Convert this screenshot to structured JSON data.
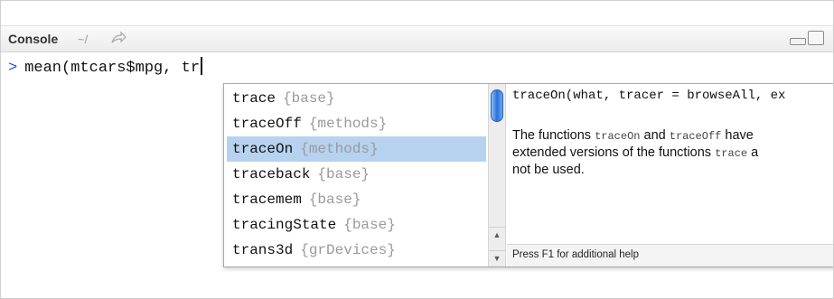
{
  "console": {
    "title": "Console",
    "path": "~/",
    "prompt_symbol": ">",
    "input_text": "mean(mtcars$mpg, tr"
  },
  "icons": {
    "path_arrow": "redirect-arrow-icon",
    "minimize": "minimize-icon",
    "maximize": "maximize-icon",
    "scroll_up": "up-arrow-icon",
    "scroll_down": "down-arrow-icon"
  },
  "completions": {
    "selected_index": 2,
    "items": [
      {
        "name": "trace",
        "package": "{base}"
      },
      {
        "name": "traceOff",
        "package": "{methods}"
      },
      {
        "name": "traceOn",
        "package": "{methods}"
      },
      {
        "name": "traceback",
        "package": "{base}"
      },
      {
        "name": "tracemem",
        "package": "{base}"
      },
      {
        "name": "tracingState",
        "package": "{base}"
      },
      {
        "name": "trans3d",
        "package": "{grDevices}"
      }
    ]
  },
  "help": {
    "signature": "traceOn(what, tracer = browseAll, ex",
    "desc_lines": [
      {
        "t1": "The functions ",
        "c1": "traceOn",
        "t2": " and ",
        "c2": "traceOff",
        "t3": " have"
      },
      {
        "t1": "extended versions of the functions ",
        "c1": "trace",
        "t2": " a",
        "c2": "",
        "t3": ""
      },
      {
        "t1": "not be used.",
        "c1": "",
        "t2": "",
        "c2": "",
        "t3": ""
      }
    ],
    "footer": "Press F1 for additional help"
  },
  "colors": {
    "prompt": "#2d4bd8",
    "selection": "#b6d2ef",
    "package_text": "#9a9a9a",
    "scroll_thumb": "#2b6fd9"
  }
}
